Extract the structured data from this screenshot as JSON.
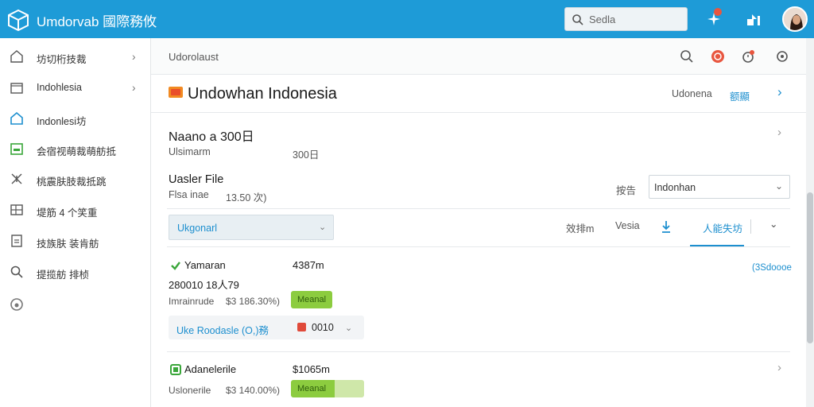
{
  "topbar": {
    "app_title": "Umdorvab 國際務攸",
    "search_placeholder": "Sedla",
    "accent": "#1e9bd7"
  },
  "sidebar": {
    "items": [
      {
        "icon": "home-icon",
        "label": "坊切桁技裁",
        "chevron": "›"
      },
      {
        "icon": "folder-icon",
        "label": "Indohlesia",
        "chevron": "›"
      },
      {
        "icon": "house-icon",
        "label": "Indonlesi坊"
      },
      {
        "icon": "calendar-icon",
        "label": "会宿视萌裁萌舫抵"
      },
      {
        "icon": "tools-icon",
        "label": "桃震肤肢裁抵跳"
      },
      {
        "icon": "grid-icon",
        "label": "堤筋 4 个笑重"
      },
      {
        "icon": "document-icon",
        "label": "技族肤 装肯舫"
      },
      {
        "icon": "search-icon",
        "label": "提揽舫 排桢"
      },
      {
        "icon": "power-icon",
        "label": ""
      }
    ]
  },
  "breadcrumb": {
    "text": "Udorolaust"
  },
  "header": {
    "title": "Undowhan Indonesia",
    "right_label": "Udonena",
    "right_link": "额顯"
  },
  "section1": {
    "title": "Naano a 300日",
    "sub_label": "Ulsimarm",
    "sub_value": "300日"
  },
  "section2": {
    "title": "Uasler File",
    "sub_label": "Flsa inae",
    "sub_value": "13.50 次)",
    "select_label": "按告",
    "select_value": "Indonhan"
  },
  "filters": {
    "dropdown_value": "Ukgonarl",
    "tabs": [
      "效排m",
      "Vesia",
      "人能失坊"
    ]
  },
  "card1": {
    "name": "Yamaran",
    "size": "4387m",
    "date": "280010 18人79",
    "meta_label": "Imrainrude",
    "meta_value": "$3 186.30%)",
    "badge": "Meanal",
    "link": "Uke Roodasle (O,)務",
    "link_num": "0010",
    "side_link": "(3Sdoooe"
  },
  "card2": {
    "name": "Adanelerile",
    "size": "$1065m",
    "meta_label": "Uslonerile",
    "meta_value": "$3 140.00%)",
    "badge": "Meanal"
  },
  "colors": {
    "link": "#1d8fcf",
    "badge": "#8ccc3f",
    "danger": "#e04a3a"
  }
}
